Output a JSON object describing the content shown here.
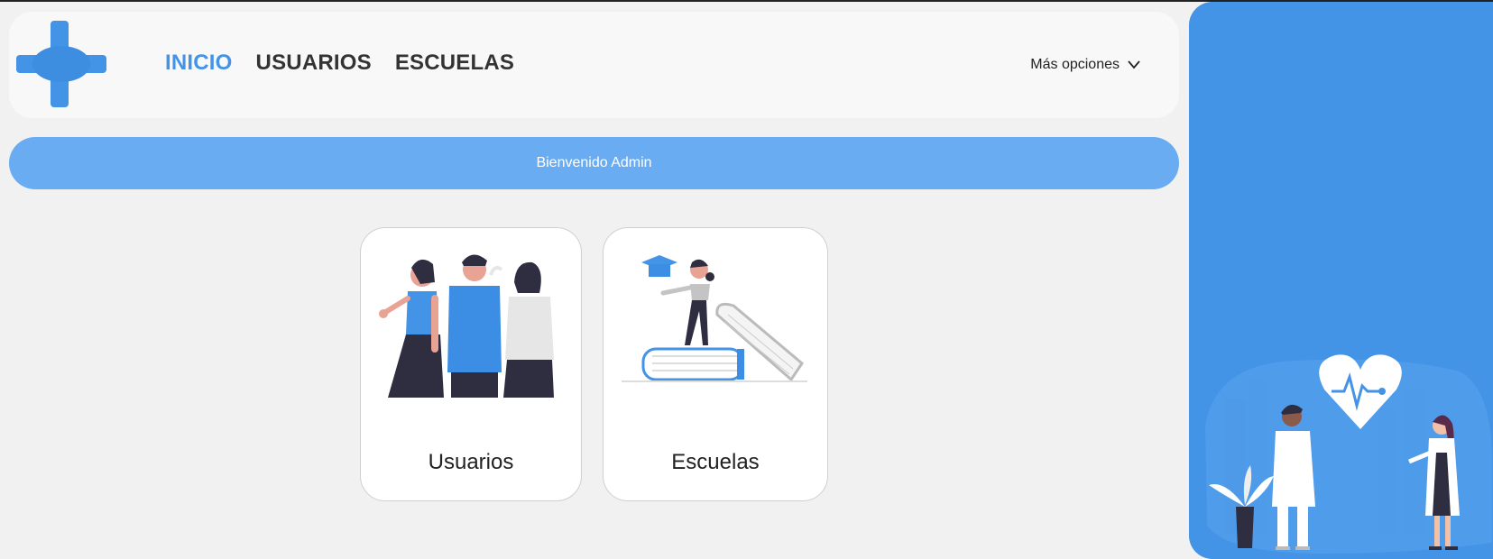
{
  "nav": {
    "links": [
      {
        "label": "INICIO",
        "active": true
      },
      {
        "label": "USUARIOS",
        "active": false
      },
      {
        "label": "ESCUELAS",
        "active": false
      }
    ],
    "more_options": "Más opciones",
    "more_icon": "chevron-down-icon"
  },
  "welcome": {
    "text": "Bienvenido Admin"
  },
  "cards": [
    {
      "label": "Usuarios",
      "illustration": "people-group-illustration"
    },
    {
      "label": "Escuelas",
      "illustration": "graduate-books-illustration"
    }
  ],
  "side_panel": {
    "illustration": "doctors-heart-illustration"
  },
  "colors": {
    "accent": "#4393e6",
    "banner": "#69acf2",
    "background": "#f1f1f1",
    "navbar": "#f8f8f8",
    "text": "#333333"
  }
}
